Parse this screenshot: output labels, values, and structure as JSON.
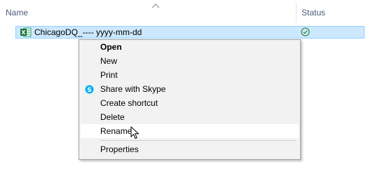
{
  "header": {
    "name_label": "Name",
    "status_label": "Status",
    "sort_indicator": "sort-ascending-chevron"
  },
  "file": {
    "name": "ChicagoDQ_---- yyyy-mm-dd",
    "icon": "excel-file-icon",
    "status_icon": "sync-check-icon",
    "selected": true
  },
  "context_menu": {
    "items": [
      {
        "label": "Open",
        "bold": true
      },
      {
        "label": "New"
      },
      {
        "label": "Print"
      },
      {
        "label": "Share with Skype",
        "icon": "skype-icon"
      },
      {
        "label": "Create shortcut"
      },
      {
        "label": "Delete"
      },
      {
        "label": "Rename",
        "hovered": true
      },
      {
        "label": "Properties"
      }
    ]
  },
  "colors": {
    "selection_bg": "#cce8ff",
    "menu_bg": "#f2f2f2",
    "skype_blue": "#00aff0",
    "status_green": "#2e7d32"
  }
}
